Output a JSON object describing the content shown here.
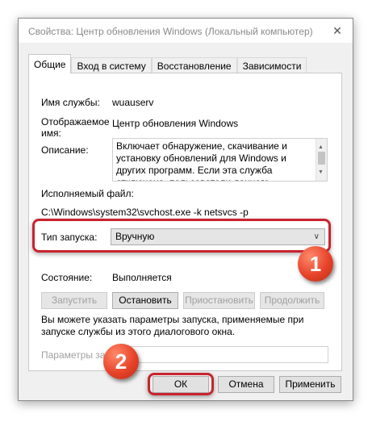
{
  "window": {
    "title": "Свойства: Центр обновления Windows (Локальный компьютер)"
  },
  "tabs": [
    {
      "label": "Общие"
    },
    {
      "label": "Вход в систему"
    },
    {
      "label": "Восстановление"
    },
    {
      "label": "Зависимости"
    }
  ],
  "general": {
    "service_name_label": "Имя службы:",
    "service_name_value": "wuauserv",
    "display_name_label": "Отображаемое имя:",
    "display_name_value": "Центр обновления Windows",
    "description_label": "Описание:",
    "description_value": "Включает обнаружение, скачивание и установку обновлений для Windows и других программ. Если эта служба отключена, пользователи данного компьютера не смогут использовать",
    "executable_label": "Исполняемый файл:",
    "executable_value": "C:\\Windows\\system32\\svchost.exe -k netsvcs -p",
    "startup_type_label": "Тип запуска:",
    "startup_type_value": "Вручную",
    "status_label": "Состояние:",
    "status_value": "Выполняется",
    "buttons": {
      "start": "Запустить",
      "stop": "Остановить",
      "pause": "Приостановить",
      "resume": "Продолжить"
    },
    "hint": "Вы можете указать параметры запуска, применяемые при запуске службы из этого диалогового окна.",
    "start_params_label": "Параметры запуска:",
    "start_params_value": ""
  },
  "footer": {
    "ok": "ОК",
    "cancel": "Отмена",
    "apply": "Применить"
  },
  "annotations": {
    "badge1": "1",
    "badge2": "2"
  },
  "colors": {
    "highlight": "#c8242f",
    "badge": "#e7432a"
  }
}
